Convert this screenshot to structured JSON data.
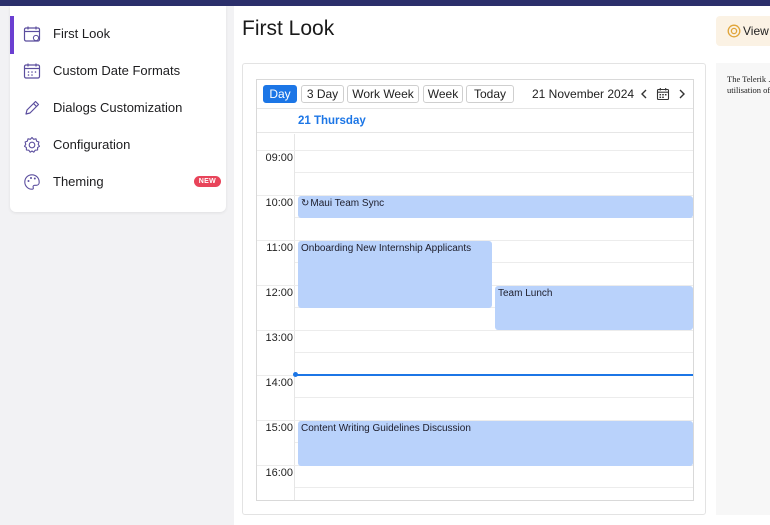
{
  "menu": {
    "items": [
      {
        "label": "First Look",
        "icon": "calendar-icon"
      },
      {
        "label": "Custom Date Formats",
        "icon": "calendar-icon"
      },
      {
        "label": "Dialogs Customization",
        "icon": "pencil-icon"
      },
      {
        "label": "Configuration",
        "icon": "gear-icon"
      },
      {
        "label": "Theming",
        "icon": "palette-icon",
        "badge": "NEW"
      }
    ],
    "active_index": 0,
    "accent_color": "#6b3fd1",
    "badge_color": "#e8445a"
  },
  "page": {
    "title": "First Look",
    "view_button_label": "View"
  },
  "info_text": "The Telerik ... you to easily ... scenarios in ... utilisation of ... definitions in ...",
  "scheduler": {
    "view_buttons": [
      "Day",
      "3 Day",
      "Work Week",
      "Week",
      "Today"
    ],
    "active_view": "Day",
    "date_label": "21 November 2024",
    "day_header": "21 Thursday",
    "accent_color": "#1c76e6",
    "time_slots": [
      "09:00",
      "10:00",
      "11:00",
      "12:00",
      "13:00",
      "14:00",
      "15:00",
      "16:00"
    ],
    "appointments": [
      {
        "title": "Maui Team Sync",
        "start": "10:00",
        "end": "10:30",
        "recurring": true
      },
      {
        "title": "Onboarding New Internship Applicants",
        "start": "11:00",
        "end": "12:30",
        "recurring": false
      },
      {
        "title": "Team Lunch",
        "start": "12:00",
        "end": "13:00",
        "recurring": false
      },
      {
        "title": "Content Writing Guidelines Discussion",
        "start": "15:00",
        "end": "16:00",
        "recurring": false
      }
    ],
    "current_time": "14:00",
    "appointment_color": "#b9d2fb"
  }
}
